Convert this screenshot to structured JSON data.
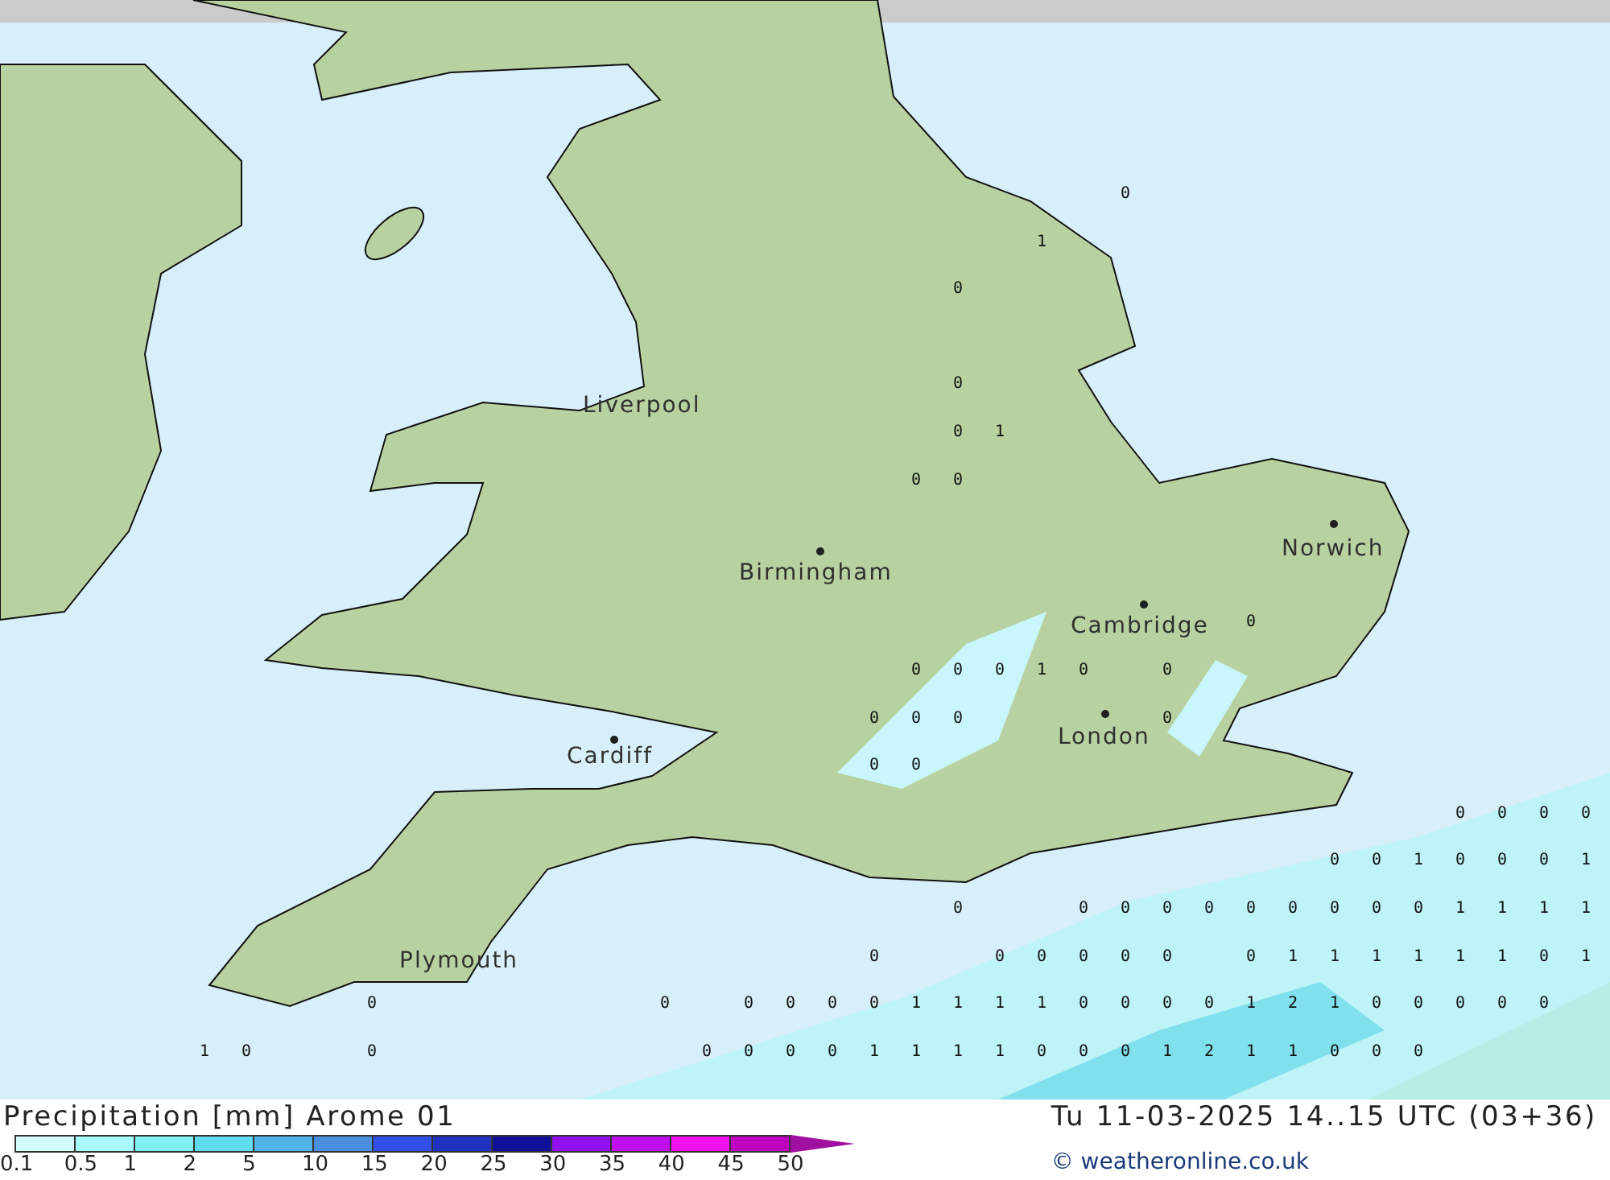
{
  "map": {
    "cities": [
      {
        "name": "Liverpool",
        "has_dot": false
      },
      {
        "name": "Birmingham",
        "has_dot": true
      },
      {
        "name": "Norwich",
        "has_dot": true
      },
      {
        "name": "Cambridge",
        "has_dot": true
      },
      {
        "name": "London",
        "has_dot": true
      },
      {
        "name": "Cardiff",
        "has_dot": true
      },
      {
        "name": "Plymouth",
        "has_dot": false
      }
    ],
    "precipitation_rows": [
      [
        null,
        null,
        null,
        null,
        null,
        null,
        null,
        null,
        null,
        null,
        null,
        null,
        null,
        null,
        null,
        null,
        null,
        null,
        null,
        null,
        null,
        null,
        "0",
        null,
        null,
        null,
        null,
        null,
        null,
        null,
        null,
        null,
        null,
        null
      ],
      [
        null,
        null,
        null,
        null,
        null,
        null,
        null,
        null,
        null,
        null,
        null,
        null,
        null,
        null,
        null,
        null,
        null,
        null,
        null,
        null,
        "1",
        null,
        null,
        null,
        null,
        null,
        null,
        null,
        null,
        null,
        null,
        null,
        null,
        null
      ],
      [
        null,
        null,
        null,
        null,
        null,
        null,
        null,
        null,
        null,
        null,
        null,
        null,
        null,
        null,
        null,
        null,
        null,
        null,
        "0",
        null,
        null,
        null,
        null,
        null,
        null,
        null,
        null,
        null,
        null,
        null,
        null,
        null,
        null,
        null
      ],
      [
        null,
        null,
        null,
        null,
        null,
        null,
        null,
        null,
        null,
        null,
        null,
        null,
        null,
        null,
        null,
        null,
        null,
        null,
        null,
        null,
        null,
        null,
        null,
        null,
        null,
        null,
        null,
        null,
        null,
        null,
        null,
        null,
        null,
        null
      ],
      [
        null,
        null,
        null,
        null,
        null,
        null,
        null,
        null,
        null,
        null,
        null,
        null,
        null,
        null,
        null,
        null,
        null,
        null,
        "0",
        null,
        null,
        null,
        null,
        null,
        null,
        null,
        null,
        null,
        null,
        null,
        null,
        null,
        null,
        null
      ],
      [
        null,
        null,
        null,
        null,
        null,
        null,
        null,
        null,
        null,
        null,
        null,
        null,
        null,
        null,
        null,
        null,
        null,
        null,
        "0",
        "1",
        null,
        null,
        null,
        null,
        null,
        null,
        null,
        null,
        null,
        null,
        null,
        null,
        null,
        null
      ],
      [
        null,
        null,
        null,
        null,
        null,
        null,
        null,
        null,
        null,
        null,
        null,
        null,
        null,
        null,
        null,
        null,
        null,
        "0",
        "0",
        null,
        null,
        null,
        null,
        null,
        null,
        null,
        null,
        null,
        null,
        null,
        null,
        null,
        null,
        null
      ],
      [
        null,
        null,
        null,
        null,
        null,
        null,
        null,
        null,
        null,
        null,
        null,
        null,
        null,
        null,
        null,
        null,
        null,
        null,
        null,
        null,
        null,
        null,
        null,
        null,
        null,
        null,
        null,
        null,
        null,
        null,
        null,
        null,
        null,
        null
      ],
      [
        null,
        null,
        null,
        null,
        null,
        null,
        null,
        null,
        null,
        null,
        null,
        null,
        null,
        null,
        null,
        null,
        null,
        null,
        null,
        null,
        null,
        null,
        null,
        null,
        null,
        null,
        null,
        null,
        null,
        null,
        null,
        null,
        null,
        null
      ],
      [
        null,
        null,
        null,
        null,
        null,
        null,
        null,
        null,
        null,
        null,
        null,
        null,
        null,
        null,
        null,
        null,
        null,
        null,
        null,
        null,
        null,
        null,
        null,
        null,
        null,
        "0",
        null,
        null,
        null,
        null,
        null,
        null,
        null,
        null
      ],
      [
        null,
        null,
        null,
        null,
        null,
        null,
        null,
        null,
        null,
        null,
        null,
        null,
        null,
        null,
        null,
        null,
        null,
        "0",
        "0",
        "0",
        "1",
        "0",
        null,
        "0",
        null,
        null,
        null,
        null,
        null,
        null,
        null,
        null,
        null,
        null
      ],
      [
        null,
        null,
        null,
        null,
        null,
        null,
        null,
        null,
        null,
        null,
        null,
        null,
        null,
        null,
        null,
        null,
        "0",
        "0",
        "0",
        null,
        null,
        null,
        null,
        "0",
        null,
        null,
        null,
        null,
        null,
        null,
        null,
        null,
        null,
        null
      ],
      [
        null,
        null,
        null,
        null,
        null,
        null,
        null,
        null,
        null,
        null,
        null,
        null,
        null,
        null,
        null,
        null,
        "0",
        "0",
        null,
        null,
        null,
        null,
        null,
        null,
        null,
        null,
        null,
        null,
        null,
        null,
        null,
        null,
        null,
        null
      ],
      [
        null,
        null,
        null,
        null,
        null,
        null,
        null,
        null,
        null,
        null,
        null,
        null,
        null,
        null,
        null,
        null,
        null,
        null,
        null,
        null,
        null,
        null,
        null,
        null,
        null,
        null,
        null,
        null,
        null,
        null,
        "0",
        "0",
        "0",
        "0"
      ],
      [
        null,
        null,
        null,
        null,
        null,
        null,
        null,
        null,
        null,
        null,
        null,
        null,
        null,
        null,
        null,
        null,
        null,
        null,
        null,
        null,
        null,
        null,
        null,
        null,
        null,
        null,
        null,
        "0",
        "0",
        "1",
        "0",
        "0",
        "0",
        "1"
      ],
      [
        null,
        null,
        null,
        null,
        null,
        null,
        null,
        null,
        null,
        null,
        null,
        null,
        null,
        null,
        null,
        null,
        null,
        null,
        "0",
        null,
        null,
        "0",
        "0",
        "0",
        "0",
        "0",
        "0",
        "0",
        "0",
        "0",
        "1",
        "1",
        "1",
        "1"
      ],
      [
        null,
        null,
        null,
        null,
        null,
        null,
        null,
        null,
        null,
        null,
        null,
        null,
        null,
        null,
        null,
        null,
        "0",
        null,
        null,
        "0",
        "0",
        "0",
        "0",
        "0",
        null,
        "0",
        "1",
        "1",
        "1",
        "1",
        "1",
        "1",
        "0",
        "1"
      ],
      [
        null,
        null,
        null,
        null,
        "0",
        null,
        null,
        null,
        null,
        null,
        null,
        "0",
        null,
        "0",
        "0",
        "0",
        "0",
        "1",
        "1",
        "1",
        "1",
        "0",
        "0",
        "0",
        "0",
        "1",
        "2",
        "1",
        "0",
        "0",
        "0",
        "0",
        "0",
        null
      ],
      [
        "1",
        "0",
        null,
        null,
        "0",
        null,
        null,
        null,
        null,
        null,
        null,
        null,
        "0",
        "0",
        "0",
        "0",
        "1",
        "1",
        "1",
        "1",
        "0",
        "0",
        "0",
        "1",
        "2",
        "1",
        "1",
        "0",
        "0",
        "0",
        null,
        null,
        null,
        null
      ]
    ]
  },
  "legend": {
    "title": "Precipitation [mm] Arome 01",
    "timestamp": "Tu 11-03-2025 14..15 UTC (03+36)",
    "swatches": [
      {
        "color": "#d4fcfc"
      },
      {
        "color": "#a8fcfc"
      },
      {
        "color": "#80f0f0"
      },
      {
        "color": "#60dcf0"
      },
      {
        "color": "#50b4e8"
      },
      {
        "color": "#4a8ee0"
      },
      {
        "color": "#3050e8"
      },
      {
        "color": "#2032c0"
      },
      {
        "color": "#101098"
      },
      {
        "color": "#9010f0"
      },
      {
        "color": "#c010f0"
      },
      {
        "color": "#f010f0"
      },
      {
        "color": "#c000c0"
      },
      {
        "color": "#a010a0",
        "kind": "arrow"
      }
    ],
    "labels": [
      "0.1",
      "0.5",
      "1",
      "2",
      "5",
      "10",
      "15",
      "20",
      "25",
      "30",
      "35",
      "40",
      "45",
      "50"
    ],
    "credit": "© weatheronline.co.uk"
  }
}
